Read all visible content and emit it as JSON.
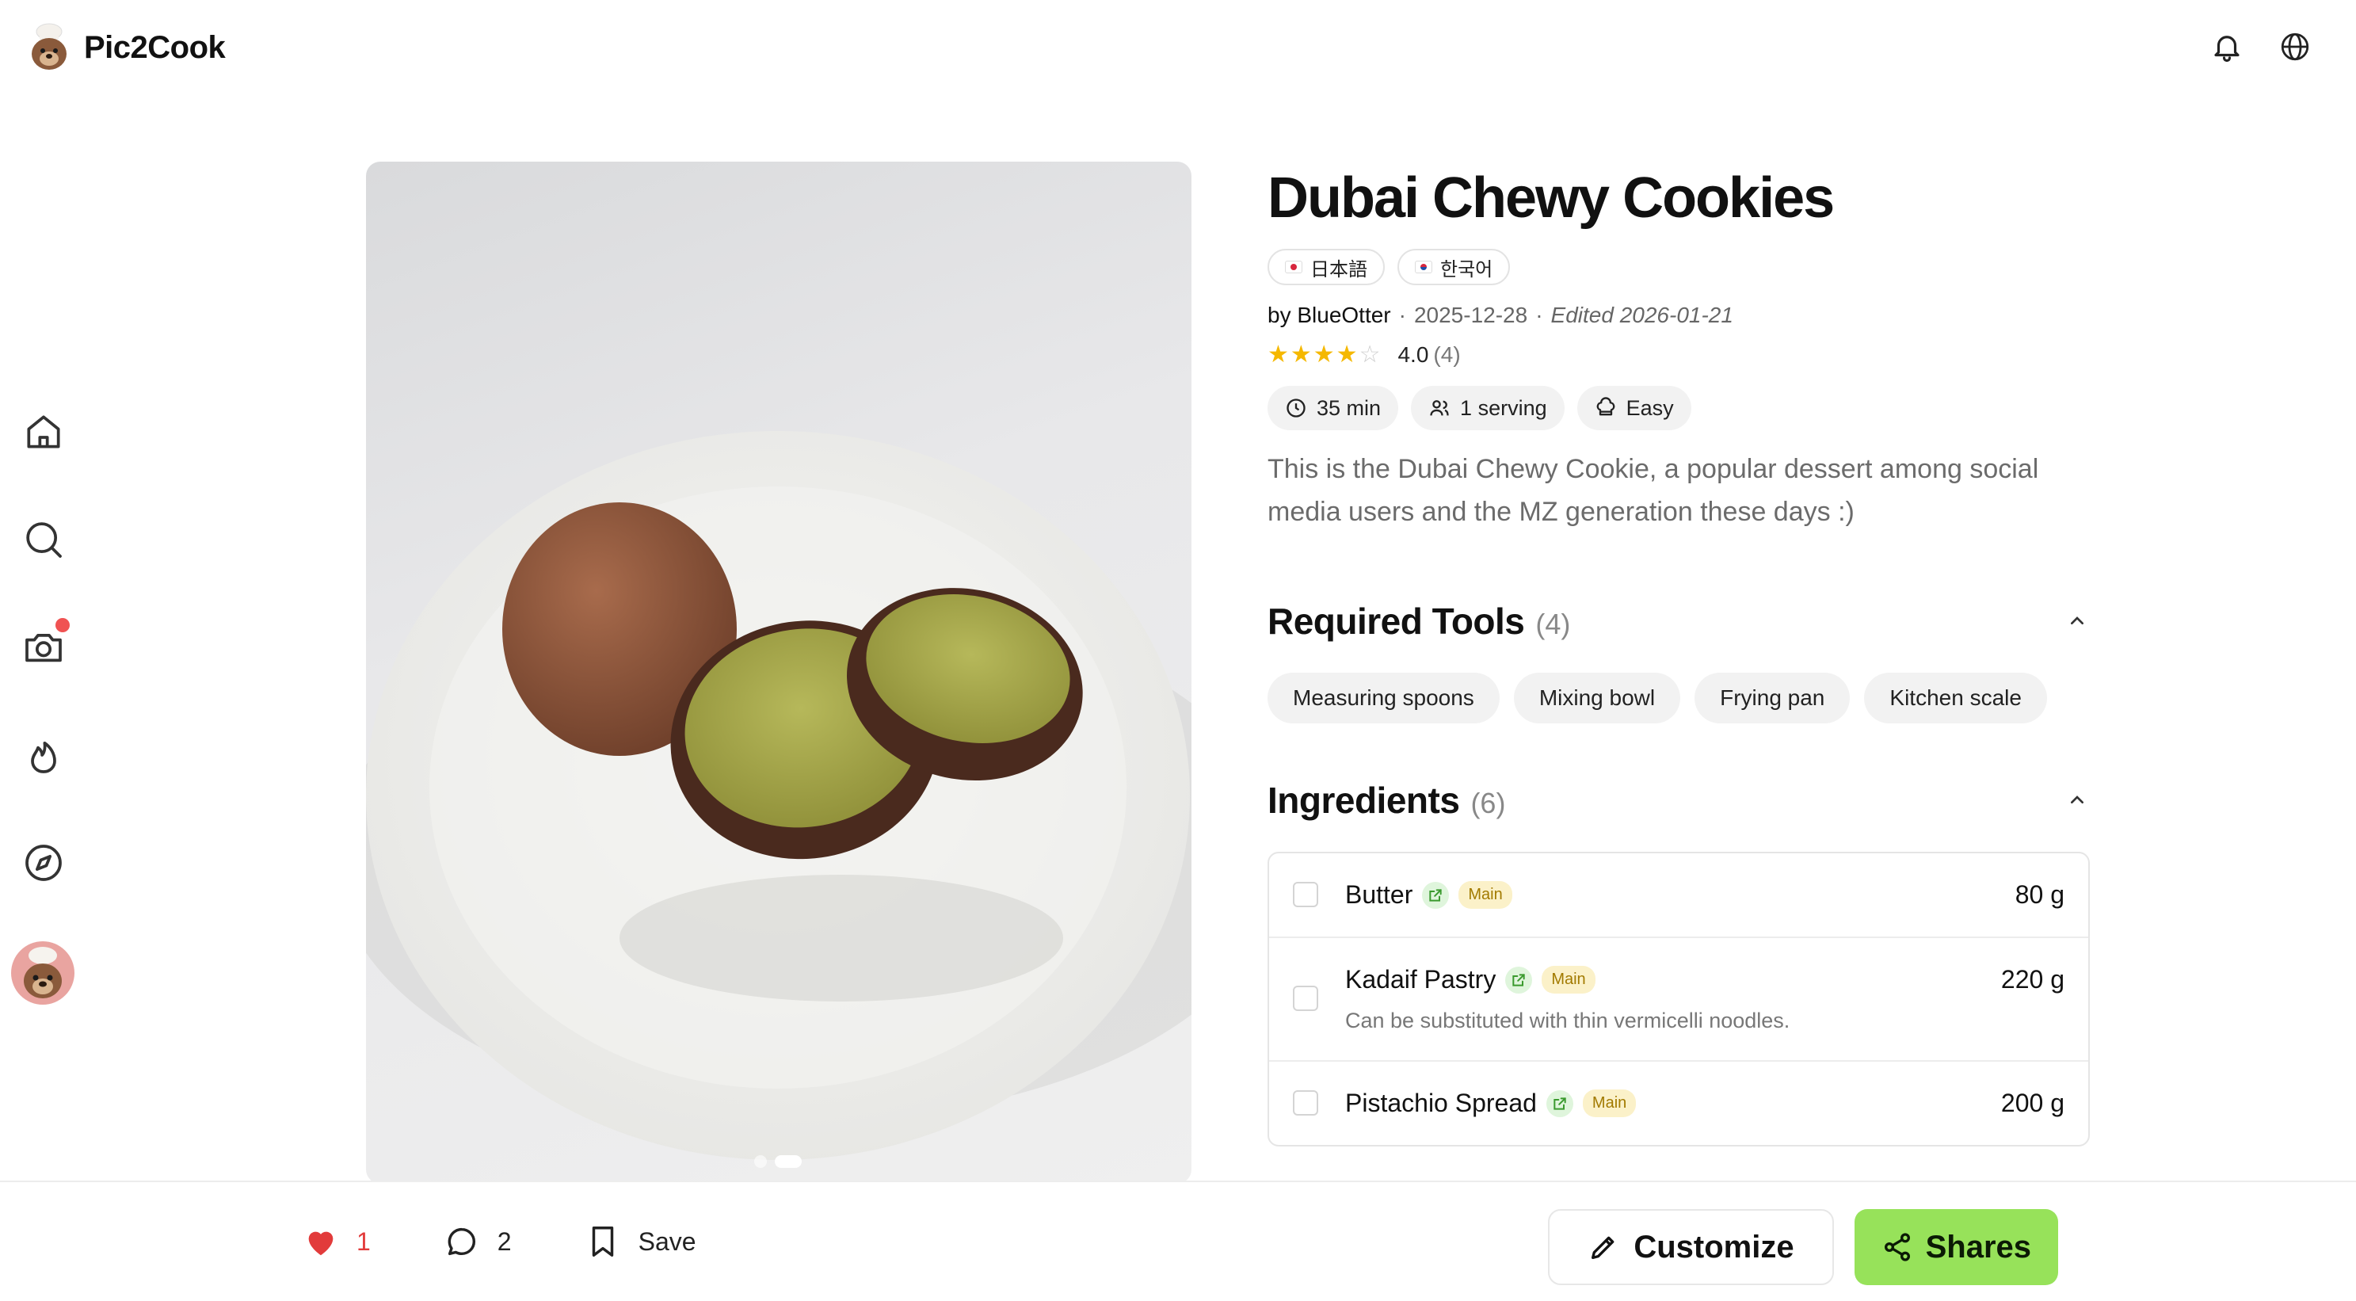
{
  "app": {
    "name": "Pic2Cook"
  },
  "header": {
    "icons": [
      "bell-icon",
      "globe-icon"
    ]
  },
  "sidebar": {
    "items": [
      "home-icon",
      "search-icon",
      "camera-icon",
      "flame-icon",
      "compass-icon"
    ],
    "has_camera_notification": true
  },
  "recipe": {
    "title": "Dubai Chewy Cookies",
    "languages": [
      {
        "label": "日本語",
        "flag": "jp"
      },
      {
        "label": "한국어",
        "flag": "kr"
      }
    ],
    "author": "by BlueOtter",
    "date": "2025-12-28",
    "edited": "Edited 2026-01-21",
    "rating": {
      "stars": 4,
      "score": "4.0",
      "count": "(4)"
    },
    "chips": {
      "time": "35 min",
      "servings": "1 serving",
      "difficulty": "Easy"
    },
    "description": "This is the Dubai Chewy Cookie, a popular dessert among social media users and the MZ generation these days :)"
  },
  "tools_section": {
    "title": "Required Tools",
    "count": "(4)",
    "items": [
      "Measuring spoons",
      "Mixing bowl",
      "Frying pan",
      "Kitchen scale"
    ]
  },
  "ingredients_section": {
    "title": "Ingredients",
    "count": "(6)",
    "items": [
      {
        "name": "Butter",
        "tag": "Main",
        "amount": "80 g",
        "note": ""
      },
      {
        "name": "Kadaif Pastry",
        "tag": "Main",
        "amount": "220 g",
        "note": "Can be substituted with thin vermicelli noodles."
      },
      {
        "name": "Pistachio Spread",
        "tag": "Main",
        "amount": "200 g",
        "note": ""
      }
    ]
  },
  "gallery": {
    "image_count": 2,
    "active_index": 1
  },
  "bottom_bar": {
    "likes": "1",
    "comments": "2",
    "save_label": "Save",
    "customize_label": "Customize",
    "shares_label": "Shares"
  },
  "colors": {
    "accent_green": "#97e25a",
    "like_red": "#e23b3b",
    "star": "#f5b800"
  }
}
